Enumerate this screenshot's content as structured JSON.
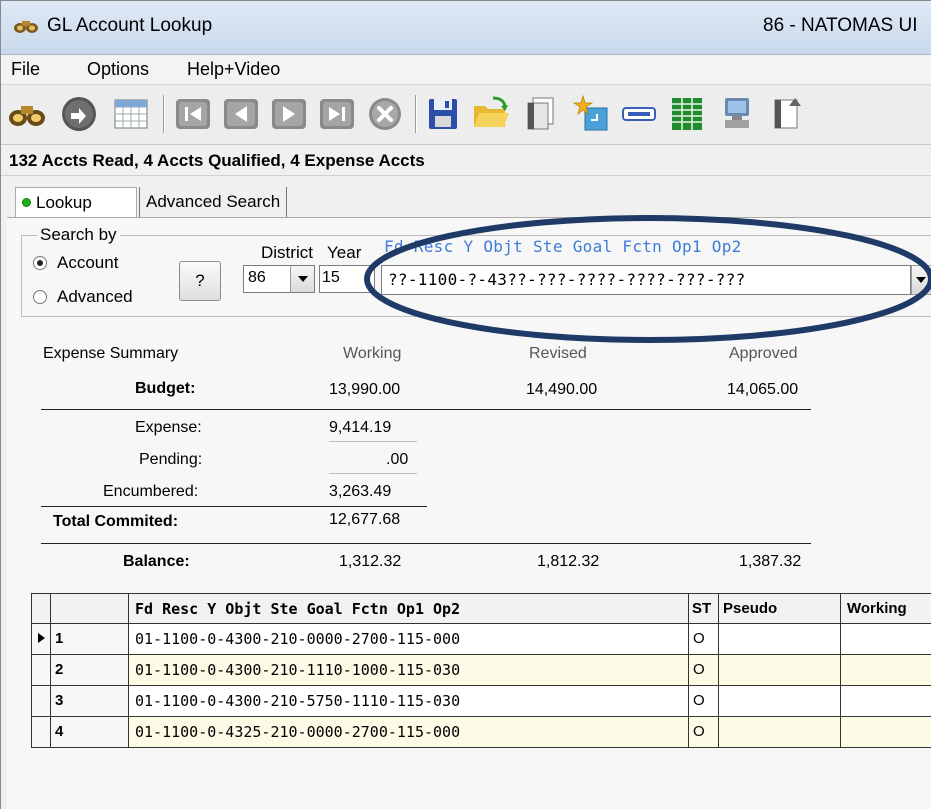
{
  "window": {
    "title": "GL Account Lookup",
    "title_right": "86 - NATOMAS UI"
  },
  "menu": {
    "items": [
      "File",
      "Options",
      "Help+Video"
    ]
  },
  "toolbar": {
    "icons": [
      "binoculars-icon",
      "back-circle-icon",
      "grid-table-icon",
      "first-record-icon",
      "previous-record-icon",
      "next-record-icon",
      "last-record-icon",
      "cancel-icon",
      "save-disk-icon",
      "open-folder-icon",
      "copy-page-icon",
      "new-star-icon",
      "minus-field-icon",
      "columns-icon",
      "computer-icon",
      "export-page-icon"
    ]
  },
  "status": {
    "text": "132 Accts Read, 4 Accts Qualified, 4 Expense Accts"
  },
  "tabs": {
    "lookup": "Lookup",
    "advanced": "Advanced Search"
  },
  "search": {
    "group_label": "Search by",
    "account_label": "Account",
    "advanced_label": "Advanced",
    "help_button": "?",
    "district_label": "District",
    "year_label": "Year",
    "district_value": "86",
    "year_value": "15",
    "account_header": "Fd Resc Y Objt Ste Goal Fctn Op1 Op2",
    "account_mask": "??-1100-?-43??-???-????-????-???-???"
  },
  "summary": {
    "title": "Expense Summary",
    "col_working": "Working",
    "col_revised": "Revised",
    "col_approved": "Approved",
    "budget_label": "Budget:",
    "budget_working": "13,990.00",
    "budget_revised": "14,490.00",
    "budget_approved": "14,065.00",
    "expense_label": "Expense:",
    "expense_working": "9,414.19",
    "pending_label": "Pending:",
    "pending_working": ".00",
    "encumbered_label": "Encumbered:",
    "encumbered_working": "3,263.49",
    "total_label": "Total Commited:",
    "total_working": "12,677.68",
    "balance_label": "Balance:",
    "balance_working": "1,312.32",
    "balance_revised": "1,812.32",
    "balance_approved": "1,387.32"
  },
  "grid": {
    "headers": {
      "account": "Fd Resc Y Objt Ste Goal Fctn Op1 Op2",
      "st": "ST",
      "pseudo": "Pseudo",
      "working": "Working"
    },
    "rows": [
      {
        "num": "1",
        "account": "01-1100-0-4300-210-0000-2700-115-000",
        "st": "O"
      },
      {
        "num": "2",
        "account": "01-1100-0-4300-210-1110-1000-115-030",
        "st": "O"
      },
      {
        "num": "3",
        "account": "01-1100-0-4300-210-5750-1110-115-030",
        "st": "O"
      },
      {
        "num": "4",
        "account": "01-1100-0-4325-210-0000-2700-115-000",
        "st": "O"
      }
    ]
  },
  "colors": {
    "accent_oval": "#1f3a66",
    "header_blue": "#3f7bd8",
    "row_yellow": "#fdfbe6",
    "active_dot": "#19b219"
  }
}
